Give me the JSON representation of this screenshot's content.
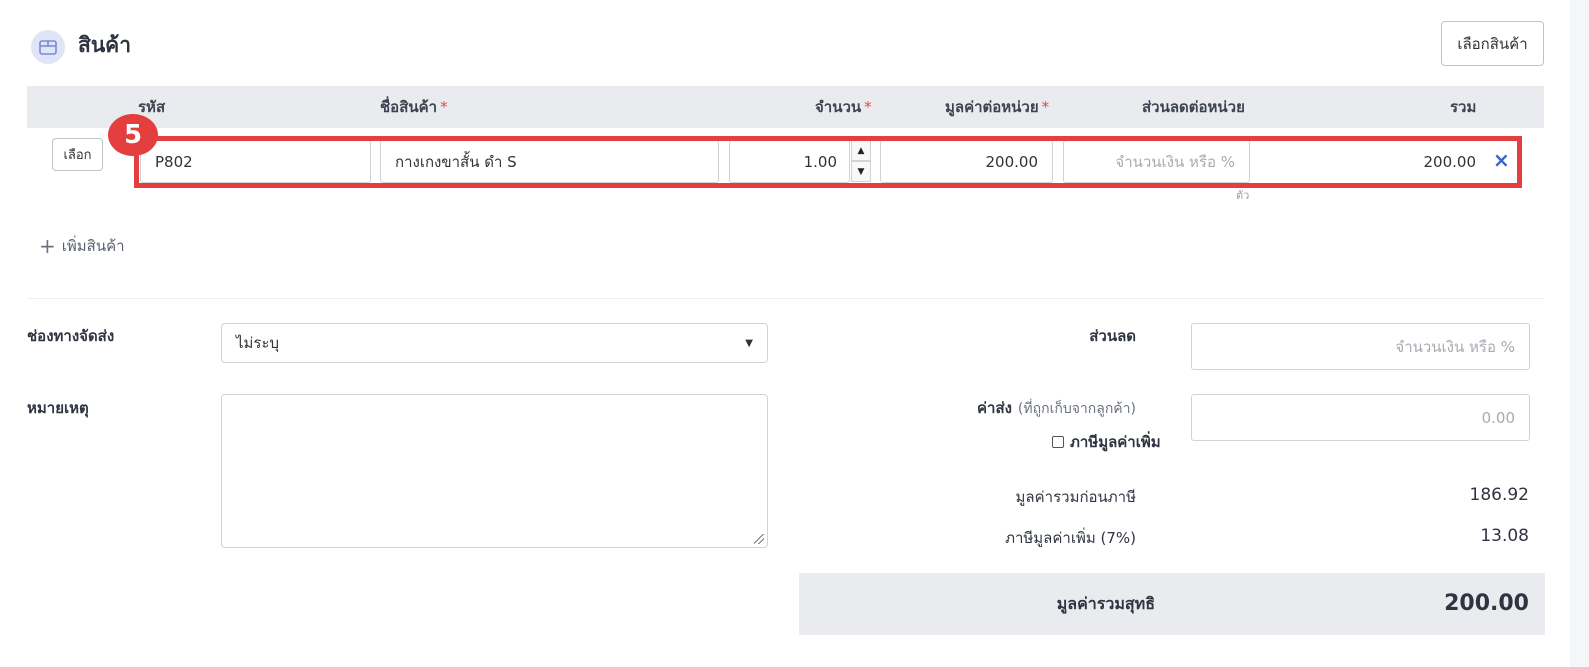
{
  "section": {
    "title": "สินค้า",
    "icon": "box-icon"
  },
  "toolbar": {
    "select_product_label": "เลือกสินค้า"
  },
  "table": {
    "headers": {
      "code": "รหัส",
      "name": "ชื่อสินค้า",
      "qty": "จำนวน",
      "unit_price": "มูลค่าต่อหน่วย",
      "discount": "ส่วนลดต่อหน่วย",
      "total": "รวม"
    },
    "required_mark": "*",
    "row": {
      "select_label": "เลือก",
      "code": "P802",
      "name": "กางเกงขาสั้น ดำ S",
      "qty": "1.00",
      "unit_price": "200.00",
      "discount_placeholder": "จำนวนเงิน หรือ %",
      "total": "200.00",
      "unit": "ตัว",
      "remove_symbol": "×"
    }
  },
  "annotation": {
    "step": "5",
    "highlight_color": "#e53e3e"
  },
  "add_product": {
    "plus": "+",
    "label": "เพิ่มสินค้า"
  },
  "shipping_channel": {
    "label": "ช่องทางจัดส่ง",
    "value": "ไม่ระบุ"
  },
  "note": {
    "label": "หมายเหตุ",
    "value": ""
  },
  "discount": {
    "label": "ส่วนลด",
    "placeholder": "จำนวนเงิน หรือ %"
  },
  "shipping_fee": {
    "label": "ค่าส่ง",
    "sub_label": "(ที่ถูกเก็บจากลูกค้า)",
    "placeholder": "0.00",
    "vat_label": "ภาษีมูลค่าเพิ่ม"
  },
  "summary": {
    "pre_tax_label": "มูลค่ารวมก่อนภาษี",
    "pre_tax_value": "186.92",
    "vat_label": "ภาษีมูลค่าเพิ่ม (7%)",
    "vat_value": "13.08",
    "net_label": "มูลค่ารวมสุทธิ",
    "net_value": "200.00"
  },
  "colors": {
    "accent": "#3b64c7",
    "required": "#e04848",
    "header_bg": "#e9ebee"
  }
}
